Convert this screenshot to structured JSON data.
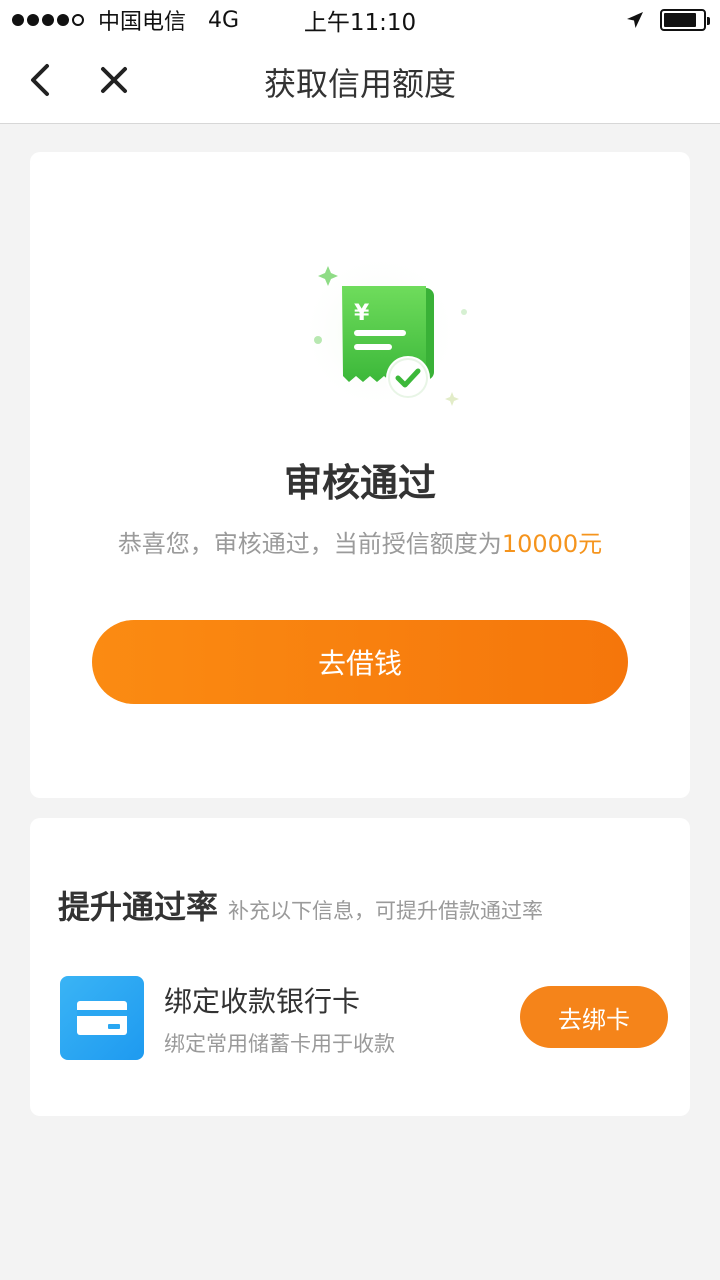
{
  "status_bar": {
    "carrier": "中国电信",
    "network": "4G",
    "time": "上午11:10",
    "signal_strength": 4
  },
  "nav": {
    "title": "获取信用额度",
    "back_icon": "chevron-left-icon",
    "close_icon": "close-icon"
  },
  "result": {
    "illustration_icon": "receipt-check-icon",
    "currency_symbol": "¥",
    "title": "审核通过",
    "desc_prefix": "恭喜您，审核通过，当前授信额度为",
    "amount": "10000元",
    "button_label": "去借钱"
  },
  "boost": {
    "title": "提升通过率",
    "subtitle": "补充以下信息，可提升借款通过率",
    "items": [
      {
        "icon": "bank-card-icon",
        "title": "绑定收款银行卡",
        "desc": "绑定常用储蓄卡用于收款",
        "button_label": "去绑卡"
      }
    ]
  },
  "colors": {
    "accent_orange": "#f5841a",
    "amount_orange": "#f5941d",
    "success_green": "#4cc84a",
    "card_icon_blue": "#1e9af0"
  }
}
